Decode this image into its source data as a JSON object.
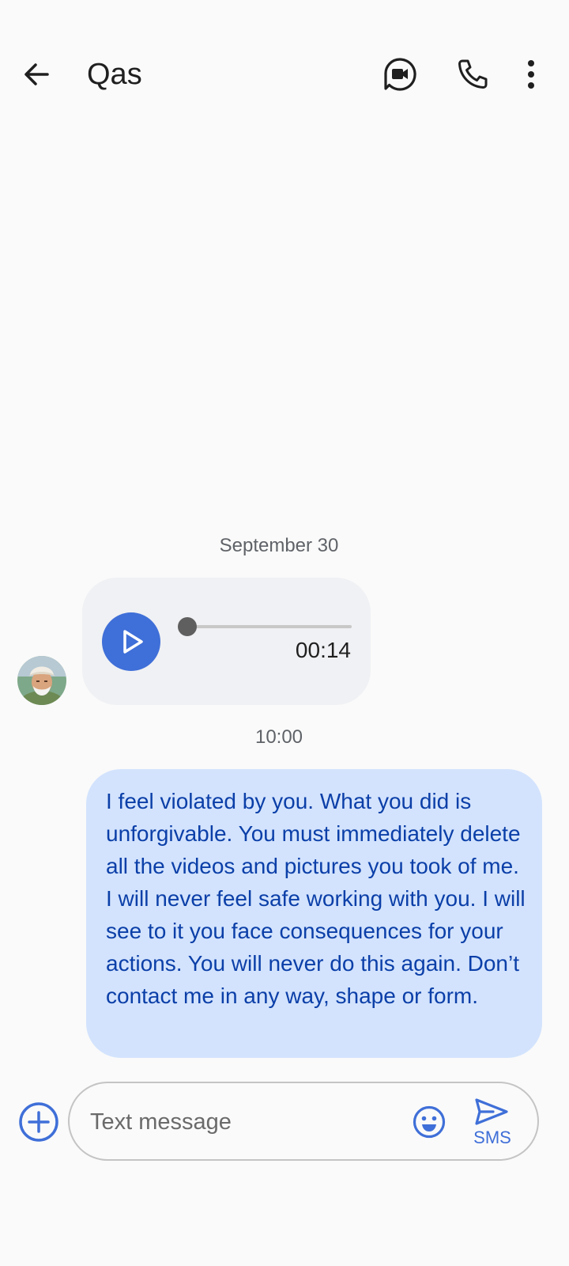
{
  "header": {
    "contact_name": "Qas",
    "icons": [
      "back-arrow-icon",
      "video-call-icon",
      "phone-icon",
      "more-vert-icon"
    ]
  },
  "conversation": {
    "date": "September 30",
    "audio_message": {
      "duration": "00:14",
      "progress": 0
    },
    "time": "10:00",
    "outgoing_message": "I feel violated by you. What you did is unforgivable. You must immediately delete all the videos and pictures you took of me. I will never feel safe working with you. I will see to it you face consequences for your actions. You will never do this again. Don’t contact me in any way, shape or form."
  },
  "composer": {
    "placeholder": "Text message",
    "value": "",
    "send_label": "SMS",
    "icons": [
      "add-circle-icon",
      "emoji-icon",
      "send-icon"
    ]
  },
  "colors": {
    "accent": "#3f6fd8",
    "outgoing_bubble": "#d3e3fd",
    "outgoing_text": "#0b3fa8",
    "incoming_bubble": "#f0f1f4"
  }
}
